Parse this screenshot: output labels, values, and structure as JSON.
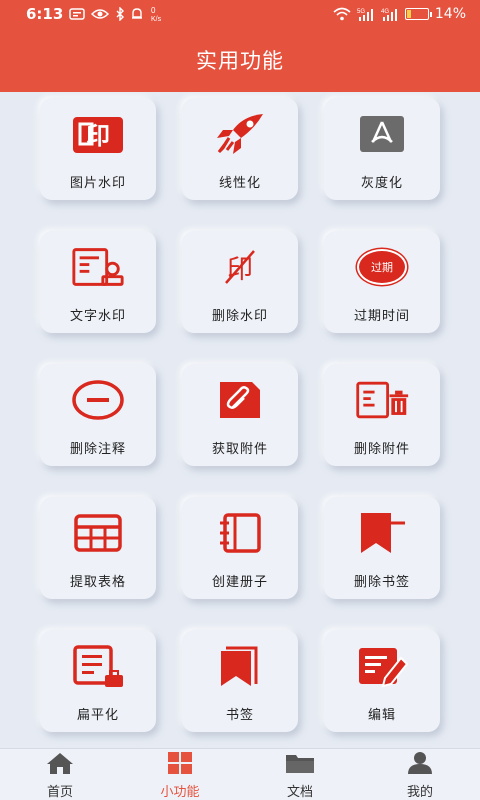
{
  "status": {
    "time": "6:13",
    "battery": "14%",
    "net_5g": "5G",
    "net_4g": "4G",
    "speed": "0 K/s"
  },
  "header": {
    "title": "实用功能"
  },
  "colors": {
    "accent": "#e5533f",
    "icon_red": "#d9281e",
    "icon_gray": "#6b6b6b",
    "background": "#e6ebf3"
  },
  "features": [
    {
      "label": "图片水印",
      "icon": "watermark-stamp-icon"
    },
    {
      "label": "线性化",
      "icon": "rocket-icon"
    },
    {
      "label": "灰度化",
      "icon": "acrobat-gray-icon"
    },
    {
      "label": "文字水印",
      "icon": "text-watermark-icon"
    },
    {
      "label": "删除水印",
      "icon": "remove-watermark-icon"
    },
    {
      "label": "过期时间",
      "icon": "expired-badge-icon",
      "badge": "过期"
    },
    {
      "label": "删除注释",
      "icon": "minus-circle-icon"
    },
    {
      "label": "获取附件",
      "icon": "paperclip-icon"
    },
    {
      "label": "删除附件",
      "icon": "delete-attachment-icon"
    },
    {
      "label": "提取表格",
      "icon": "table-icon"
    },
    {
      "label": "创建册子",
      "icon": "booklet-icon"
    },
    {
      "label": "删除书签",
      "icon": "delete-bookmark-icon"
    },
    {
      "label": "扁平化",
      "icon": "flatten-icon"
    },
    {
      "label": "书签",
      "icon": "bookmark-icon"
    },
    {
      "label": "编辑",
      "icon": "edit-icon"
    }
  ],
  "tabs": [
    {
      "label": "首页",
      "icon": "home-icon"
    },
    {
      "label": "小功能",
      "icon": "grid-icon",
      "active": true
    },
    {
      "label": "文档",
      "icon": "folder-icon"
    },
    {
      "label": "我的",
      "icon": "user-icon"
    }
  ]
}
